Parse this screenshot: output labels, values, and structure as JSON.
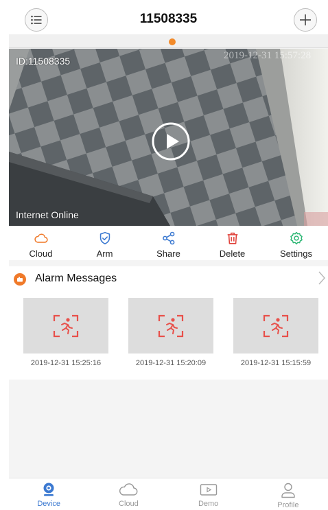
{
  "header": {
    "title": "11508335"
  },
  "video": {
    "id_label": "ID:11508335",
    "status": "Internet Online",
    "timestamp": "2019-12-31 15:57:28"
  },
  "actions": [
    {
      "label": "Cloud",
      "icon": "cloud-icon",
      "color": "#f07a2a"
    },
    {
      "label": "Arm",
      "icon": "shield-check-icon",
      "color": "#3b79d1"
    },
    {
      "label": "Share",
      "icon": "share-icon",
      "color": "#3b79d1"
    },
    {
      "label": "Delete",
      "icon": "trash-icon",
      "color": "#e0413a"
    },
    {
      "label": "Settings",
      "icon": "gear-icon",
      "color": "#2bb673"
    }
  ],
  "alarm": {
    "title": "Alarm Messages",
    "items": [
      {
        "time": "2019-12-31 15:25:16",
        "icon": "motion-detect-icon"
      },
      {
        "time": "2019-12-31 15:20:09",
        "icon": "motion-detect-icon"
      },
      {
        "time": "2019-12-31 15:15:59",
        "icon": "motion-detect-icon"
      }
    ]
  },
  "tabs": [
    {
      "label": "Device",
      "icon": "device-icon",
      "active": true
    },
    {
      "label": "Cloud",
      "icon": "cloud-icon",
      "active": false
    },
    {
      "label": "Demo",
      "icon": "demo-play-icon",
      "active": false
    },
    {
      "label": "Profile",
      "icon": "profile-icon",
      "active": false
    }
  ],
  "colors": {
    "accent_orange": "#f07a2a",
    "accent_blue": "#3b79d1",
    "delete_red": "#e0413a",
    "settings_green": "#2bb673"
  }
}
